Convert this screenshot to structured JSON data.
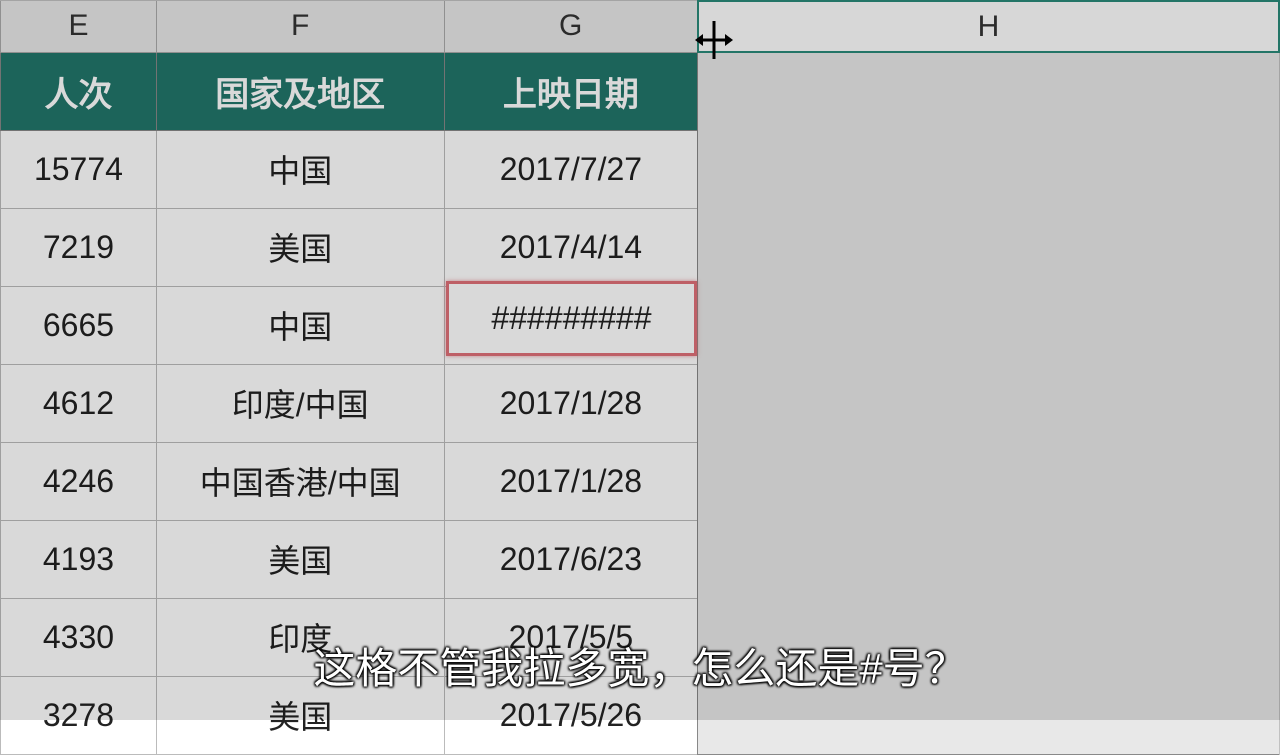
{
  "columns": {
    "E": "E",
    "F": "F",
    "G": "G",
    "H": "H"
  },
  "headers": {
    "E": "人次",
    "F": "国家及地区",
    "G": "上映日期"
  },
  "rows": [
    {
      "e": "15774",
      "f": "中国",
      "g": "2017/7/27"
    },
    {
      "e": "7219",
      "f": "美国",
      "g": "2017/4/14"
    },
    {
      "e": "6665",
      "f": "中国",
      "g": "#########"
    },
    {
      "e": "4612",
      "f": "印度/中国",
      "g": "2017/1/28"
    },
    {
      "e": "4246",
      "f": "中国香港/中国",
      "g": "2017/1/28"
    },
    {
      "e": "4193",
      "f": "美国",
      "g": "2017/6/23"
    },
    {
      "e": "4330",
      "f": "印度",
      "g": "2017/5/5"
    },
    {
      "e": "3278",
      "f": "美国",
      "g": "2017/5/26"
    }
  ],
  "highlight": {
    "row_index": 2
  },
  "subtitle": "这格不管我拉多宽，怎么还是#号？",
  "colors": {
    "header_bg": "#21766a",
    "highlight_border": "#e07078"
  }
}
